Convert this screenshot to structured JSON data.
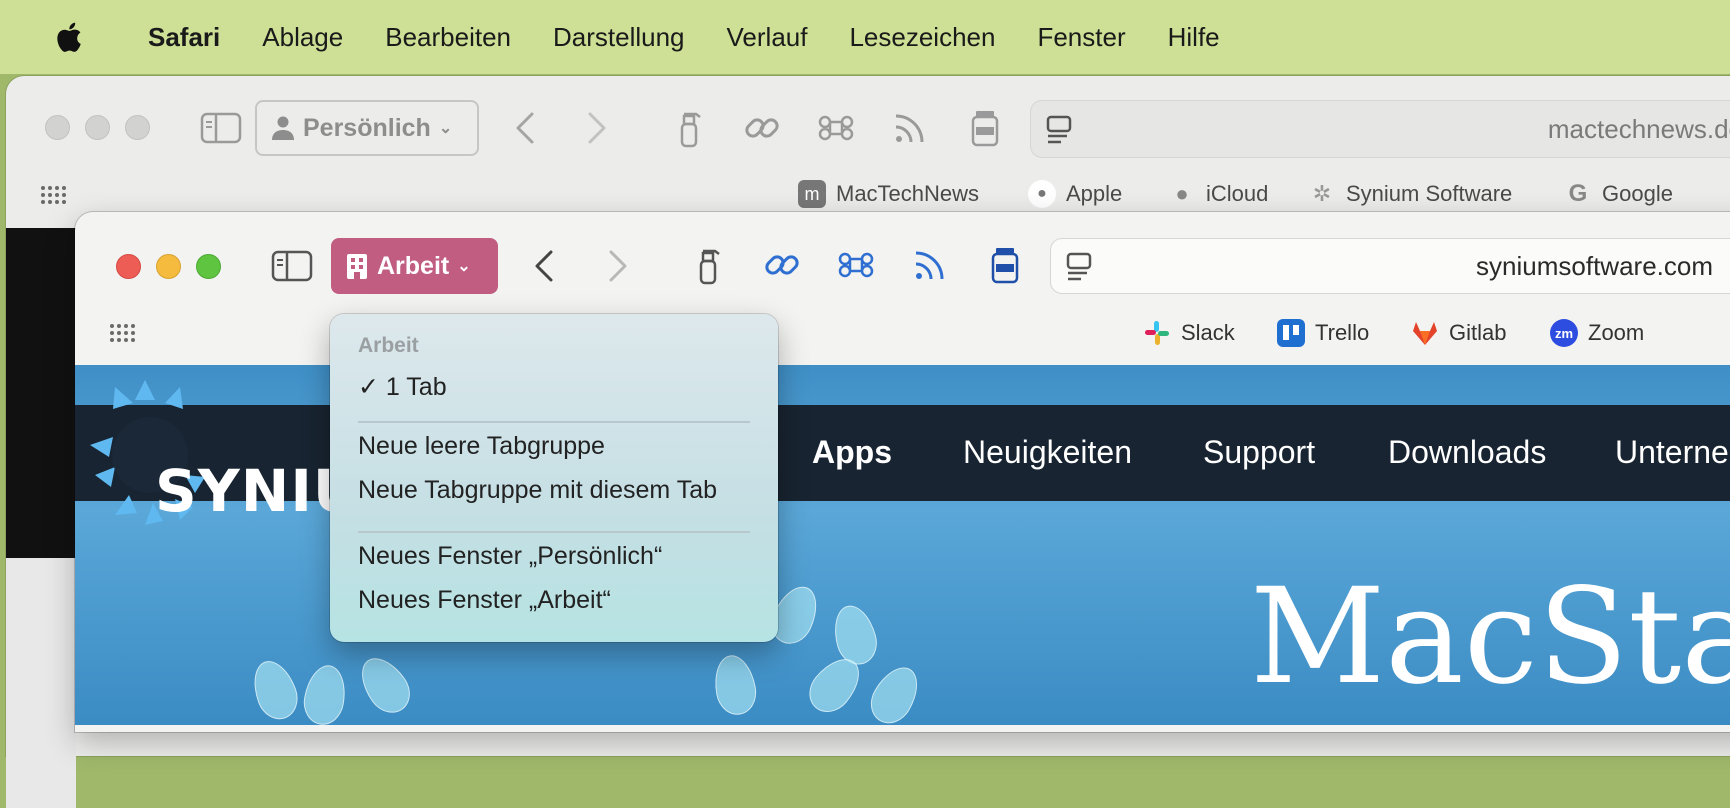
{
  "menubar": {
    "app": "Safari",
    "items": [
      "Ablage",
      "Bearbeiten",
      "Darstellung",
      "Verlauf",
      "Lesezeichen",
      "Fenster",
      "Hilfe"
    ]
  },
  "back_window": {
    "tab_group": "Persönlich",
    "url": "mactechnews.de",
    "favorites": [
      "MacTechNews",
      "Apple",
      "iCloud",
      "Synium Software",
      "Google"
    ]
  },
  "front_window": {
    "tab_group": "Arbeit",
    "url": "syniumsoftware.com",
    "favorites": [
      "Slack",
      "Trello",
      "Gitlab",
      "Zoom"
    ]
  },
  "website": {
    "logo": "SYNIU",
    "nav": [
      "Apps",
      "Neuigkeiten",
      "Support",
      "Downloads",
      "Unterne"
    ],
    "hero_title": "MacStar"
  },
  "dropdown": {
    "header": "Arbeit",
    "checked_item": "✓ 1 Tab",
    "items": [
      "Neue leere Tabgruppe",
      "Neue Tabgruppe mit diesem Tab",
      "Neues Fenster „Persönlich“",
      "Neues Fenster „Arbeit“"
    ]
  },
  "colors": {
    "menubar_bg": "#cde095",
    "tab_group_active": "#c05d80",
    "accent_blue": "#2f6fd1",
    "site_nav_bg": "#182431"
  },
  "icons": [
    "apple-logo-icon",
    "sidebar-icon",
    "person-icon",
    "building-icon",
    "chevron-left-icon",
    "chevron-right-icon",
    "spray-bottle-icon",
    "link-icon",
    "command-icon",
    "feed-icon",
    "jar-icon",
    "reader-icon",
    "grid-icon"
  ]
}
